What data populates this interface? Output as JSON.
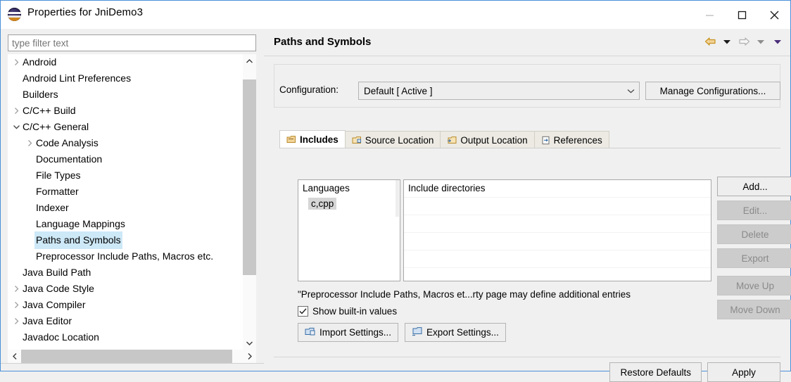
{
  "window": {
    "title": "Properties for JniDemo3",
    "app_icon": "eclipse-logo",
    "minimize": "—",
    "maximize": "□",
    "close": "✕"
  },
  "filter": {
    "placeholder": "type filter text",
    "value": ""
  },
  "tree": {
    "items": [
      {
        "label": "Android",
        "indent": 0,
        "arrow": "collapsed",
        "selected": false
      },
      {
        "label": "Android Lint Preferences",
        "indent": 0,
        "arrow": "none",
        "selected": false
      },
      {
        "label": "Builders",
        "indent": 0,
        "arrow": "none",
        "selected": false
      },
      {
        "label": "C/C++ Build",
        "indent": 0,
        "arrow": "collapsed",
        "selected": false
      },
      {
        "label": "C/C++ General",
        "indent": 0,
        "arrow": "expanded",
        "selected": false
      },
      {
        "label": "Code Analysis",
        "indent": 1,
        "arrow": "collapsed",
        "selected": false
      },
      {
        "label": "Documentation",
        "indent": 1,
        "arrow": "none",
        "selected": false
      },
      {
        "label": "File Types",
        "indent": 1,
        "arrow": "none",
        "selected": false
      },
      {
        "label": "Formatter",
        "indent": 1,
        "arrow": "none",
        "selected": false
      },
      {
        "label": "Indexer",
        "indent": 1,
        "arrow": "none",
        "selected": false
      },
      {
        "label": "Language Mappings",
        "indent": 1,
        "arrow": "none",
        "selected": false
      },
      {
        "label": "Paths and Symbols",
        "indent": 1,
        "arrow": "none",
        "selected": true
      },
      {
        "label": "Preprocessor Include Paths, Macros etc.",
        "indent": 1,
        "arrow": "none",
        "selected": false
      },
      {
        "label": "Java Build Path",
        "indent": 0,
        "arrow": "none",
        "selected": false
      },
      {
        "label": "Java Code Style",
        "indent": 0,
        "arrow": "collapsed",
        "selected": false
      },
      {
        "label": "Java Compiler",
        "indent": 0,
        "arrow": "collapsed",
        "selected": false
      },
      {
        "label": "Java Editor",
        "indent": 0,
        "arrow": "collapsed",
        "selected": false
      },
      {
        "label": "Javadoc Location",
        "indent": 0,
        "arrow": "none",
        "selected": false
      }
    ]
  },
  "page": {
    "title": "Paths and Symbols",
    "nav": {
      "back_icon": "back-arrow-icon",
      "back_menu_icon": "chevron-down-icon",
      "forward_icon": "forward-arrow-icon",
      "forward_menu_icon": "chevron-down-icon",
      "more_icon": "chevron-down-icon"
    }
  },
  "configuration": {
    "label": "Configuration:",
    "selected": "Default  [ Active ]",
    "options": [
      "Default  [ Active ]"
    ],
    "manage_label": "Manage Configurations..."
  },
  "tabs": [
    {
      "label": "Includes",
      "icon": "includes-folder-icon",
      "active": true
    },
    {
      "label": "Source Location",
      "icon": "source-folder-icon",
      "active": false
    },
    {
      "label": "Output Location",
      "icon": "output-folder-icon",
      "active": false
    },
    {
      "label": "References",
      "icon": "references-file-icon",
      "active": false
    }
  ],
  "includes_tab": {
    "languages": {
      "header": "Languages",
      "items": [
        "c,cpp"
      ],
      "selected": "c,cpp"
    },
    "directories": {
      "header": "Include directories",
      "entries": [],
      "empty_row_count": 5
    },
    "note": "\"Preprocessor Include Paths, Macros et...rty page may define additional entries",
    "show_builtin": {
      "label": "Show built-in values",
      "checked": true
    },
    "import_label": "Import Settings...",
    "import_icon": "import-settings-icon",
    "export_label": "Export Settings...",
    "export_icon": "export-settings-icon",
    "side_buttons": [
      {
        "label": "Add...",
        "enabled": true,
        "gap": false
      },
      {
        "label": "Edit...",
        "enabled": false,
        "gap": false
      },
      {
        "label": "Delete",
        "enabled": false,
        "gap": false
      },
      {
        "label": "Export",
        "enabled": false,
        "gap": false
      },
      {
        "label": "Move Up",
        "enabled": false,
        "gap": true
      },
      {
        "label": "Move Down",
        "enabled": false,
        "gap": false
      }
    ]
  },
  "footer": {
    "restore_defaults": "Restore Defaults",
    "apply": "Apply"
  },
  "colors": {
    "selection_blue": "#cde8f7",
    "window_border": "#4a90d9",
    "dialog_bg": "#f0f0f0",
    "button_face": "#eeeeee",
    "disabled_button": "#cccccc",
    "back_arrow_gold": "#d9a020",
    "tab_inactive": "#eceae3"
  }
}
